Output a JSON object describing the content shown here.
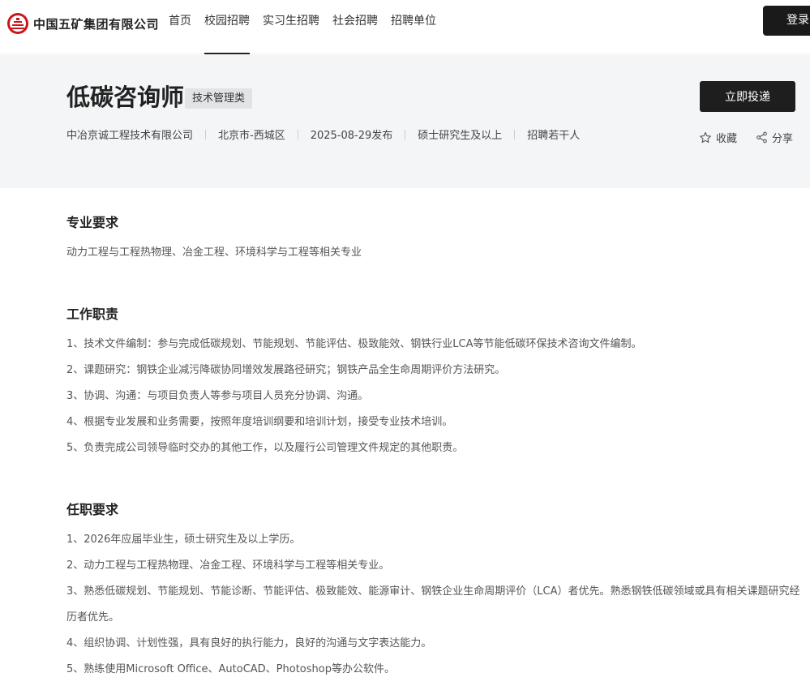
{
  "header": {
    "logo_text": "中国五矿集团有限公司",
    "nav": [
      "首页",
      "校园招聘",
      "实习生招聘",
      "社会招聘",
      "招聘单位"
    ],
    "active_nav_index": 1,
    "login_label": "登录"
  },
  "job": {
    "title": "低碳咨询师",
    "tag": "技术管理类",
    "company": "中冶京诚工程技术有限公司",
    "location": "北京市-西城区",
    "published": "2025-08-29发布",
    "education": "硕士研究生及以上",
    "headcount": "招聘若干人",
    "apply_label": "立即投递",
    "favorite_label": "收藏",
    "share_label": "分享"
  },
  "sections": {
    "major": {
      "title": "专业要求",
      "items": [
        "动力工程与工程热物理、冶金工程、环境科学与工程等相关专业"
      ]
    },
    "duties": {
      "title": "工作职责",
      "items": [
        "1、技术文件编制：参与完成低碳规划、节能规划、节能评估、极致能效、钢铁行业LCA等节能低碳环保技术咨询文件编制。",
        "2、课题研究：钢铁企业减污降碳协同增效发展路径研究；钢铁产品全生命周期评价方法研究。",
        "3、协调、沟通：与项目负责人等参与项目人员充分协调、沟通。",
        "4、根据专业发展和业务需要，按照年度培训纲要和培训计划，接受专业技术培训。",
        "5、负责完成公司领导临时交办的其他工作，以及履行公司管理文件规定的其他职责。"
      ]
    },
    "requirements": {
      "title": "任职要求",
      "items": [
        "1、2026年应届毕业生，硕士研究生及以上学历。",
        "2、动力工程与工程热物理、冶金工程、环境科学与工程等相关专业。",
        "3、熟悉低碳规划、节能规划、节能诊断、节能评估、极致能效、能源审计、钢铁企业生命周期评价（LCA）者优先。熟悉钢铁低碳领域或具有相关课题研究经历者优先。",
        "4、组织协调、计划性强，具有良好的执行能力，良好的沟通与文字表达能力。",
        "5、熟练使用Microsoft Office、AutoCAD、Photoshop等办公软件。"
      ]
    }
  },
  "colors": {
    "hero_bg": "#f4f5f7",
    "dark_button": "#1e1e1e",
    "logo_red": "#c8161d"
  }
}
